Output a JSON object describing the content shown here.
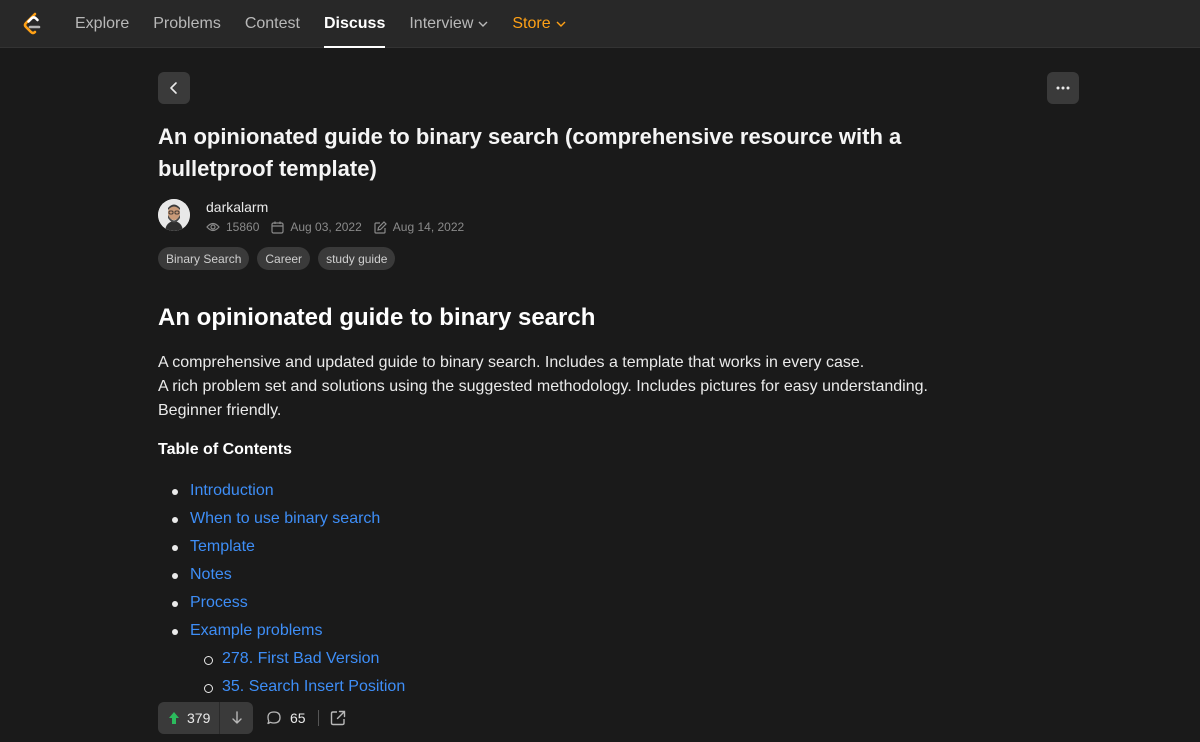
{
  "nav": {
    "items": [
      {
        "label": "Explore"
      },
      {
        "label": "Problems"
      },
      {
        "label": "Contest"
      },
      {
        "label": "Discuss"
      },
      {
        "label": "Interview"
      },
      {
        "label": "Store"
      }
    ],
    "accent_color": "#ffa116"
  },
  "post": {
    "title": "An opinionated guide to binary search (comprehensive resource with a bulletproof template)",
    "author": "darkalarm",
    "views": "15860",
    "created": "Aug 03, 2022",
    "edited": "Aug 14, 2022",
    "tags": [
      "Binary Search",
      "Career",
      "study guide"
    ]
  },
  "content": {
    "heading": "An opinionated guide to binary search",
    "intro": [
      "A comprehensive and updated guide to binary search. Includes a template that works in every case.",
      "A rich problem set and solutions using the suggested methodology. Includes pictures for easy understanding.",
      "Beginner friendly."
    ],
    "toc_title": "Table of Contents",
    "toc": [
      "Introduction",
      "When to use binary search",
      "Template",
      "Notes",
      "Process",
      "Example problems",
      "278. First Bad Version",
      "35. Search Insert Position"
    ],
    "link_color": "#3e8ef7"
  },
  "actions": {
    "upvotes": "379",
    "comments": "65",
    "upvote_color": "#2cbb5d"
  },
  "icons": {
    "logo": "leetcode-logo-icon",
    "back": "chevron-left-icon",
    "more": "more-horizontal-icon",
    "views": "eye-icon",
    "created": "calendar-icon",
    "edited": "edit-icon",
    "upvote": "arrow-up-icon",
    "downvote": "arrow-down-icon",
    "comments": "comment-icon",
    "share": "share-icon"
  }
}
